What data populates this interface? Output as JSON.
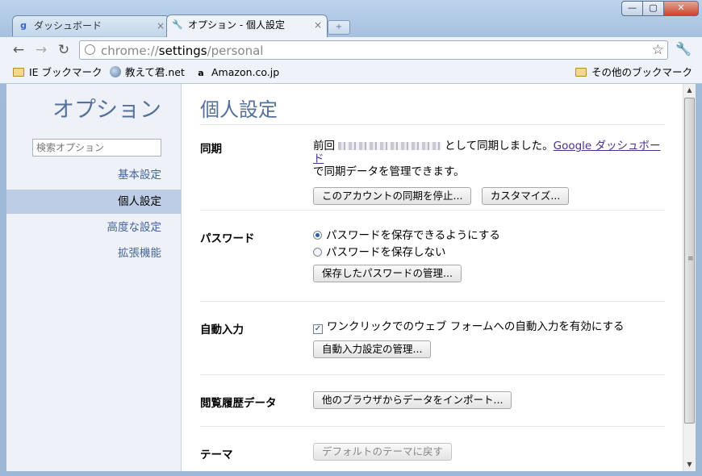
{
  "window": {
    "controls": {
      "minimize": "—",
      "maximize": "▢",
      "close": "✕"
    },
    "tabs": [
      {
        "label": "ダッシュボード",
        "icon": "google-icon",
        "close": "×"
      },
      {
        "label": "オプション - 個人設定",
        "icon": "wrench-icon",
        "close": "×"
      }
    ],
    "new_tab_label": "+"
  },
  "toolbar": {
    "url_scheme": "chrome://",
    "url_host": "settings",
    "url_path": "/personal"
  },
  "bookmarks": {
    "items": [
      "IE ブックマーク",
      "教えて君.net",
      "Amazon.co.jp"
    ],
    "other": "その他のブックマーク"
  },
  "sidebar": {
    "title": "オプション",
    "search_placeholder": "検索オプション",
    "items": [
      "基本設定",
      "個人設定",
      "高度な設定",
      "拡張機能"
    ],
    "selected_index": 1
  },
  "main": {
    "title": "個人設定",
    "sync": {
      "label": "同期",
      "text_before": "前回",
      "text_after": "として同期しました。",
      "dashboard_link": "Google ダッシュボード",
      "text_line2": "で同期データを管理できます。",
      "stop_button": "このアカウントの同期を停止...",
      "customize_button": "カスタマイズ..."
    },
    "password": {
      "label": "パスワード",
      "option_save": "パスワードを保存できるようにする",
      "option_nosave": "パスワードを保存しない",
      "selected": "save",
      "manage_button": "保存したパスワードの管理..."
    },
    "autofill": {
      "label": "自動入力",
      "checkbox_label": "ワンクリックでのウェブ フォームへの自動入力を有効にする",
      "checked": true,
      "manage_button": "自動入力設定の管理..."
    },
    "history": {
      "label": "閲覧履歴データ",
      "import_button": "他のブラウザからデータをインポート..."
    },
    "theme": {
      "label": "テーマ",
      "reset_button": "デフォルトのテーマに戻す"
    }
  }
}
